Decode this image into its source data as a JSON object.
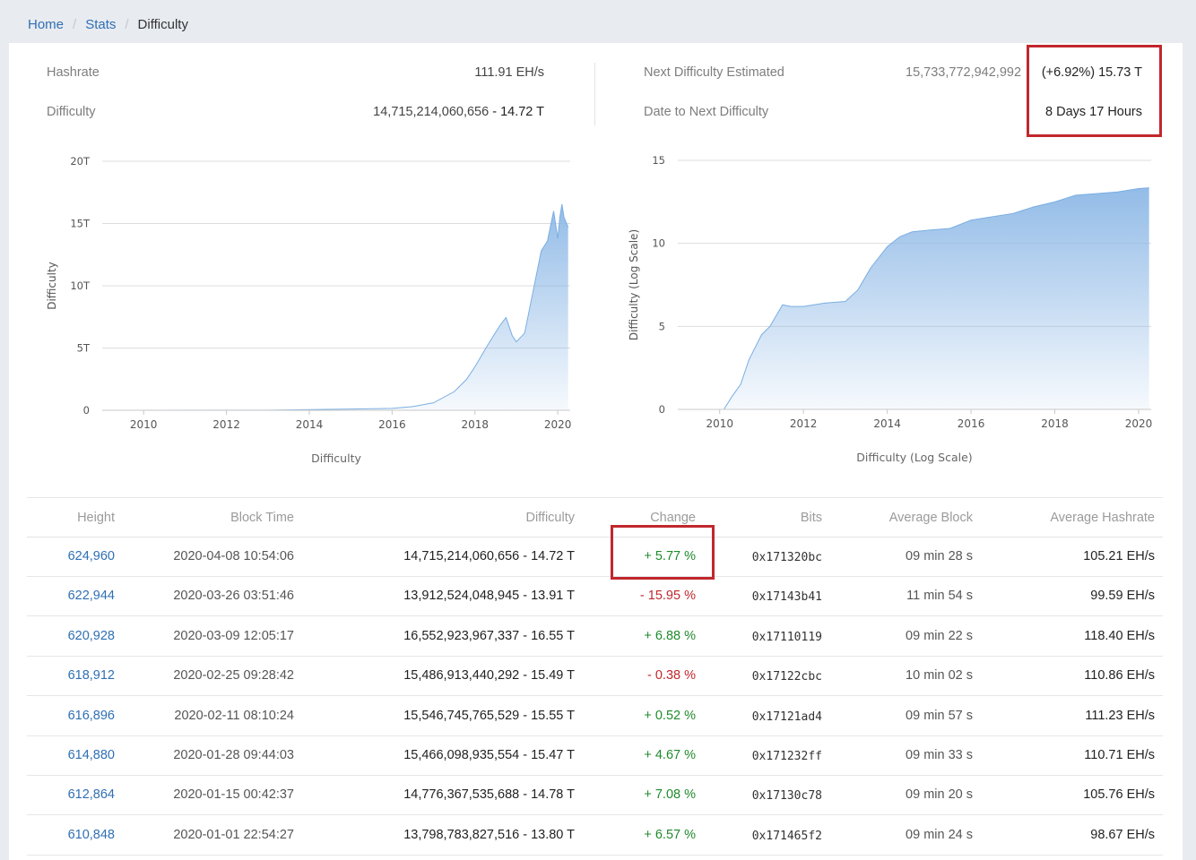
{
  "breadcrumb": {
    "home": "Home",
    "stats": "Stats",
    "current": "Difficulty"
  },
  "summary": {
    "hashrate_label": "Hashrate",
    "hashrate_value": "111.91 EH/s",
    "difficulty_label": "Difficulty",
    "difficulty_value": "14,715,214,060,656",
    "difficulty_short": "- 14.72 T",
    "next_label": "Next Difficulty Estimated",
    "next_value": "15,733,772,942,992",
    "next_change": "(+6.92%) 15.73 T",
    "date_label": "Date to Next Difficulty",
    "date_value": "8 Days 17 Hours"
  },
  "colors": {
    "link": "#2f6fb3",
    "positive": "#1f8a2b",
    "negative": "#c1272d",
    "highlight": "#c1272d",
    "area": "#8db8e6"
  },
  "chart_data": [
    {
      "type": "area",
      "title": "Difficulty",
      "ylabel": "Difficulty",
      "xlabel": "",
      "ylim": [
        0,
        20
      ],
      "xlim": [
        2009,
        2020.3
      ],
      "y_ticks": [
        "0",
        "5T",
        "10T",
        "15T",
        "20T"
      ],
      "x_ticks": [
        "2010",
        "2012",
        "2014",
        "2016",
        "2018",
        "2020"
      ],
      "grid": true,
      "x": [
        2009.0,
        2013.0,
        2014.0,
        2015.0,
        2016.0,
        2016.5,
        2017.0,
        2017.5,
        2017.8,
        2018.0,
        2018.3,
        2018.6,
        2018.75,
        2018.9,
        2019.0,
        2019.2,
        2019.4,
        2019.6,
        2019.75,
        2019.9,
        2020.0,
        2020.05,
        2020.1,
        2020.15,
        2020.25
      ],
      "y": [
        0,
        0.01,
        0.05,
        0.1,
        0.15,
        0.3,
        0.6,
        1.5,
        2.5,
        3.5,
        5.2,
        6.8,
        7.45,
        6.0,
        5.5,
        6.2,
        9.5,
        12.8,
        13.6,
        16.0,
        13.8,
        15.5,
        16.55,
        15.5,
        14.7
      ]
    },
    {
      "type": "area",
      "title": "Difficulty (Log Scale)",
      "ylabel": "Difficulty (Log Scale)",
      "xlabel": "",
      "ylim": [
        0,
        15
      ],
      "xlim": [
        2009,
        2020.3
      ],
      "y_ticks": [
        "0",
        "5",
        "10",
        "15"
      ],
      "x_ticks": [
        "2010",
        "2012",
        "2014",
        "2016",
        "2018",
        "2020"
      ],
      "grid": true,
      "x": [
        2009.0,
        2010.1,
        2010.3,
        2010.5,
        2010.7,
        2011.0,
        2011.2,
        2011.5,
        2011.7,
        2012.0,
        2012.5,
        2013.0,
        2013.3,
        2013.6,
        2014.0,
        2014.3,
        2014.6,
        2015.0,
        2015.5,
        2016.0,
        2016.5,
        2017.0,
        2017.5,
        2018.0,
        2018.5,
        2019.0,
        2019.5,
        2020.0,
        2020.25
      ],
      "y": [
        0,
        0,
        0.8,
        1.5,
        3.0,
        4.5,
        5.0,
        6.3,
        6.2,
        6.2,
        6.4,
        6.5,
        7.2,
        8.5,
        9.8,
        10.4,
        10.7,
        10.8,
        10.9,
        11.4,
        11.6,
        11.8,
        12.2,
        12.5,
        12.9,
        13.0,
        13.1,
        13.3,
        13.35
      ]
    }
  ],
  "table": {
    "headers": [
      "Height",
      "Block Time",
      "Difficulty",
      "Change",
      "Bits",
      "Average Block",
      "Average Hashrate"
    ],
    "rows": [
      {
        "height": "624,960",
        "time": "2020-04-08 10:54:06",
        "difficulty": "14,715,214,060,656 - 14.72 T",
        "change": "+ 5.77 %",
        "dir": "pos",
        "bits": "0x171320bc",
        "avg_block": "09 min 28 s",
        "avg_hashrate": "105.21 EH/s"
      },
      {
        "height": "622,944",
        "time": "2020-03-26 03:51:46",
        "difficulty": "13,912,524,048,945 - 13.91 T",
        "change": "- 15.95 %",
        "dir": "neg",
        "bits": "0x17143b41",
        "avg_block": "11 min 54 s",
        "avg_hashrate": "99.59 EH/s"
      },
      {
        "height": "620,928",
        "time": "2020-03-09 12:05:17",
        "difficulty": "16,552,923,967,337 - 16.55 T",
        "change": "+ 6.88 %",
        "dir": "pos",
        "bits": "0x17110119",
        "avg_block": "09 min 22 s",
        "avg_hashrate": "118.40 EH/s"
      },
      {
        "height": "618,912",
        "time": "2020-02-25 09:28:42",
        "difficulty": "15,486,913,440,292 - 15.49 T",
        "change": "- 0.38 %",
        "dir": "neg",
        "bits": "0x17122cbc",
        "avg_block": "10 min 02 s",
        "avg_hashrate": "110.86 EH/s"
      },
      {
        "height": "616,896",
        "time": "2020-02-11 08:10:24",
        "difficulty": "15,546,745,765,529 - 15.55 T",
        "change": "+ 0.52 %",
        "dir": "pos",
        "bits": "0x17121ad4",
        "avg_block": "09 min 57 s",
        "avg_hashrate": "111.23 EH/s"
      },
      {
        "height": "614,880",
        "time": "2020-01-28 09:44:03",
        "difficulty": "15,466,098,935,554 - 15.47 T",
        "change": "+ 4.67 %",
        "dir": "pos",
        "bits": "0x171232ff",
        "avg_block": "09 min 33 s",
        "avg_hashrate": "110.71 EH/s"
      },
      {
        "height": "612,864",
        "time": "2020-01-15 00:42:37",
        "difficulty": "14,776,367,535,688 - 14.78 T",
        "change": "+ 7.08 %",
        "dir": "pos",
        "bits": "0x17130c78",
        "avg_block": "09 min 20 s",
        "avg_hashrate": "105.76 EH/s"
      },
      {
        "height": "610,848",
        "time": "2020-01-01 22:54:27",
        "difficulty": "13,798,783,827,516 - 13.80 T",
        "change": "+ 6.57 %",
        "dir": "pos",
        "bits": "0x171465f2",
        "avg_block": "09 min 24 s",
        "avg_hashrate": "98.67 EH/s"
      }
    ]
  }
}
